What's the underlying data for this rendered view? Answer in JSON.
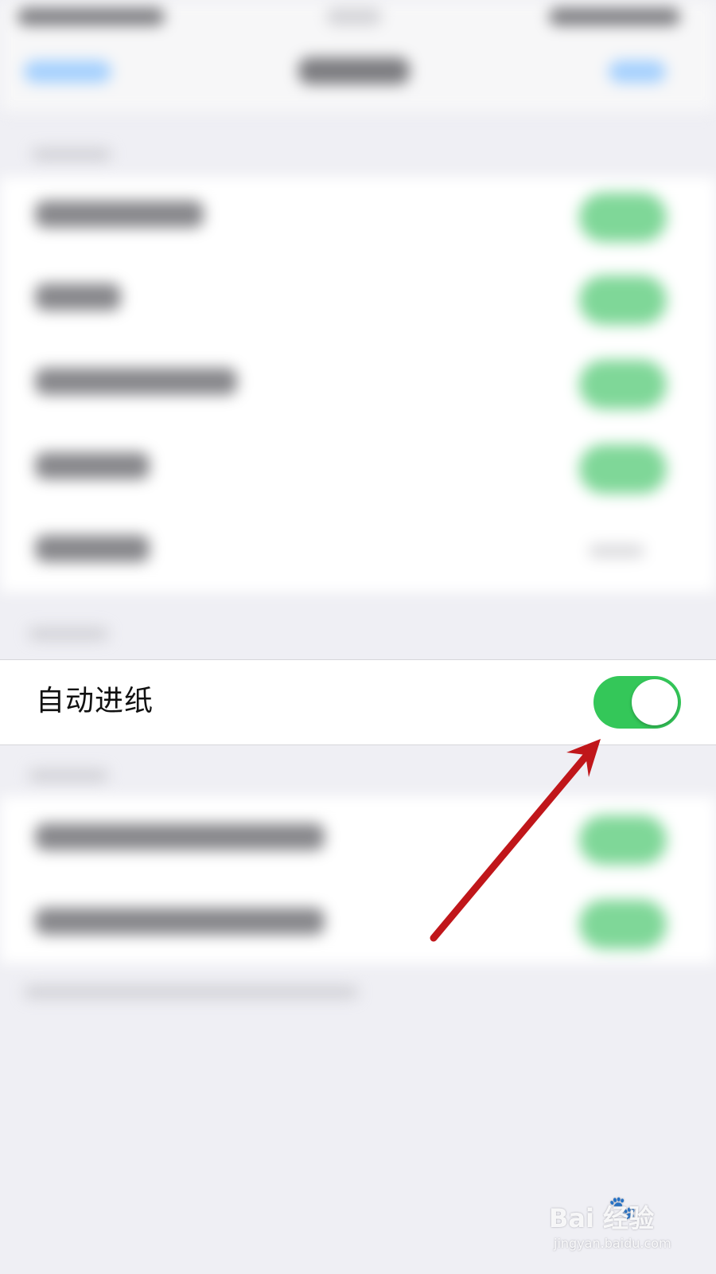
{
  "setting": {
    "label": "自动进纸",
    "enabled": true
  },
  "watermark": {
    "brand": "Bai  经验",
    "url": "jingyan.baidu.com"
  },
  "colors": {
    "toggle_on": "#34c759",
    "arrow": "#c0161a"
  }
}
